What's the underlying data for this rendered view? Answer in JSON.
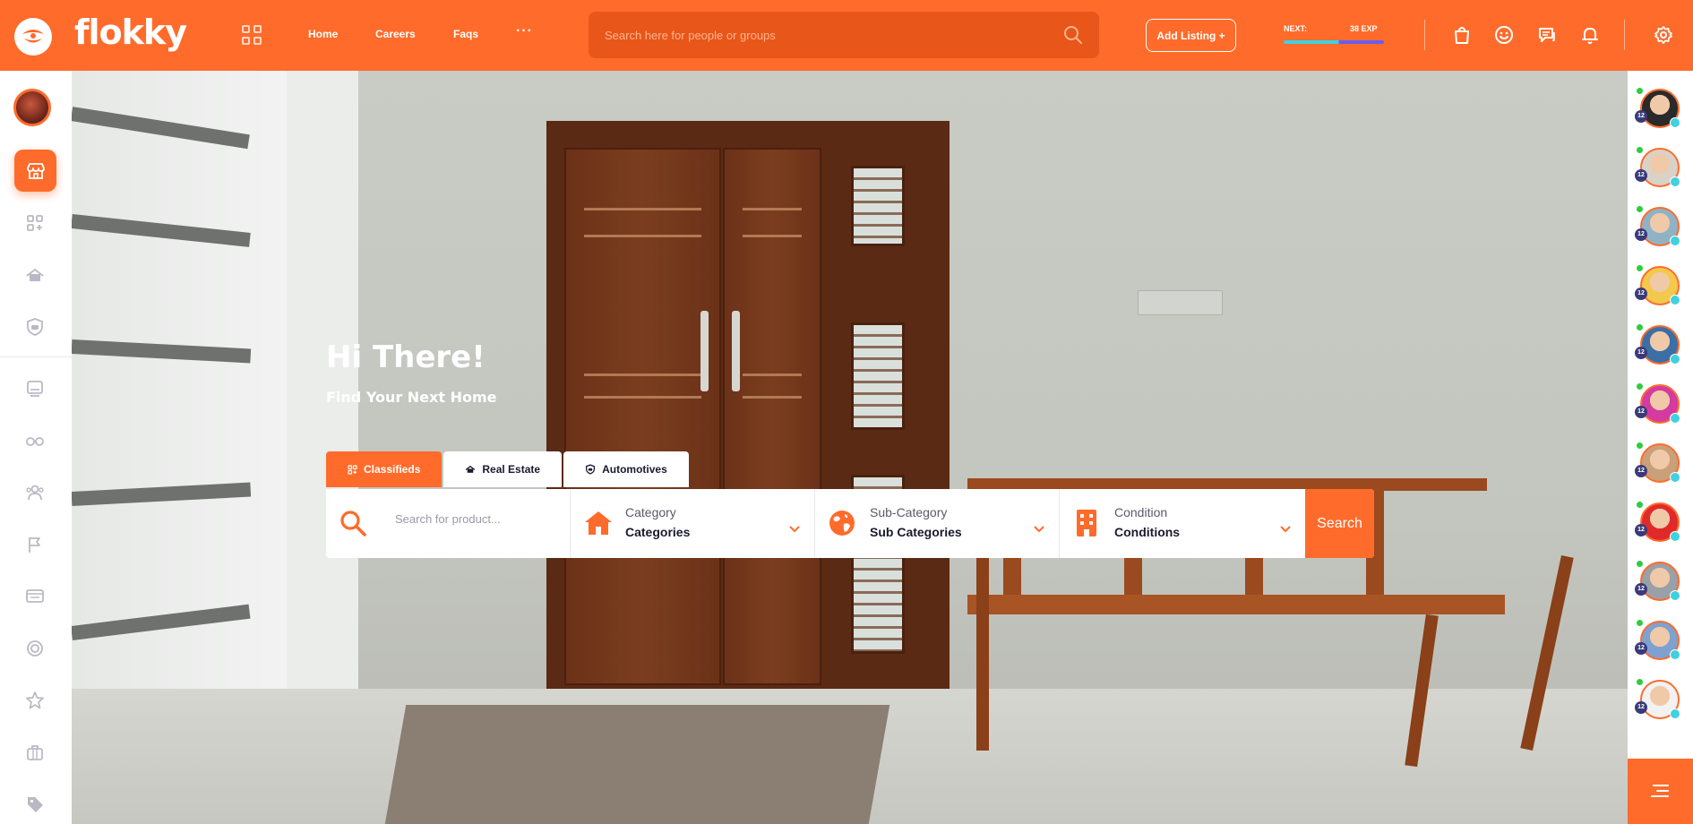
{
  "brand": {
    "logo_text": "flokky"
  },
  "nav": {
    "home": "Home",
    "careers": "Careers",
    "faqs": "Faqs",
    "more": "···"
  },
  "search": {
    "placeholder": "Search here for people or groups"
  },
  "header": {
    "add_listing": "Add Listing +",
    "exp_next_label": "NEXT:",
    "exp_value": "38 EXP"
  },
  "hero": {
    "title": "Hi There!",
    "subtitle": "Find Your Next Home"
  },
  "tabs": {
    "classifieds": "Classifieds",
    "real_estate": "Real Estate",
    "automotives": "Automotives"
  },
  "search_panel": {
    "product_placeholder": "Search for product...",
    "category_label": "Category",
    "category_value": "Categories",
    "subcategory_label": "Sub-Category",
    "subcategory_value": "Sub Categories",
    "condition_label": "Condition",
    "condition_value": "Conditions",
    "search_button": "Search"
  },
  "right_sidebar": {
    "level_badge": "12"
  },
  "colors": {
    "accent": "#ff6b2b",
    "accent_dark": "#e8561a",
    "online": "#2ecc40",
    "verified": "#40d0e0"
  },
  "icons": {
    "left_sidebar": [
      "marketplace-icon",
      "apps-icon",
      "real-estate-icon",
      "automotive-icon",
      "newsfeed-icon",
      "glasses-icon",
      "groups-icon",
      "flag-icon",
      "forum-icon",
      "target-icon",
      "star-icon",
      "briefcase-icon",
      "tag-icon"
    ],
    "header": [
      "bag-icon",
      "smiley-icon",
      "messages-icon",
      "bell-icon",
      "gear-icon"
    ]
  }
}
